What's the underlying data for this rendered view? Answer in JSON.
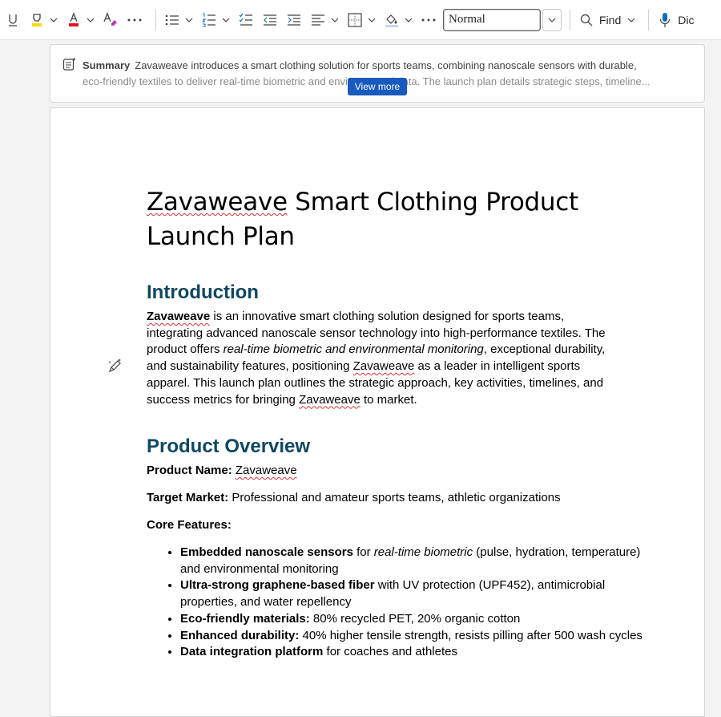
{
  "toolbar": {
    "style_value": "Normal",
    "find_label": "Find",
    "dictate_label": "Dic",
    "icons": [
      "underline-icon",
      "highlight-icon",
      "font-color-icon",
      "clear-formatting-icon",
      "more-icon",
      "bullets-icon",
      "numbering-icon",
      "checklist-icon",
      "decrease-indent-icon",
      "increase-indent-icon",
      "align-icon",
      "borders-icon",
      "shading-icon",
      "more-icon",
      "search-icon",
      "microphone-icon"
    ],
    "colors": {
      "font_color_bar": "#e81123",
      "highlight_bar": "#ffd800",
      "accent": "#185abd"
    }
  },
  "summary": {
    "title": "Summary",
    "line1": "Zavaweave introduces a smart clothing solution for sports teams, combining nanoscale sensors with durable,",
    "line2": "eco-friendly textiles to deliver real-time biometric and environmental data. The launch plan details strategic steps, timeline...",
    "view_more": "View more"
  },
  "document": {
    "title": "Zavaweave Smart Clothing Product Launch Plan",
    "intro": {
      "heading": "Introduction",
      "brand": "Zavaweave",
      "p1": " is an innovative smart clothing solution designed for sports teams, integrating advanced nanoscale sensor technology into high-performance textiles. The product offers ",
      "p2_italic": "real-time biometric and environmental monitoring",
      "p3": ", exceptional durability, and sustainability features, positioning ",
      "p4": " as a leader in intelligent sports apparel. This launch plan outlines the strategic approach, key activities, timelines, and success metrics for bringing ",
      "p5": " to market."
    },
    "overview": {
      "heading": "Product Overview",
      "product_name_label": "Product Name:",
      "product_name_value": "Zavaweave",
      "target_label": "Target Market:",
      "target_value": " Professional and amateur sports teams, athletic organizations",
      "core_label": "Core Features:",
      "features": [
        {
          "bold": "Embedded nanoscale sensors",
          "pre": " for ",
          "italic": "real-time biometric",
          "post": " (pulse, hydration, temperature) and environmental monitoring"
        },
        {
          "bold": "Ultra-strong graphene-based fiber",
          "pre": " with UV protection (UPF452), antimicrobial properties, and water repellency",
          "italic": "",
          "post": ""
        },
        {
          "bold": "Eco-friendly materials:",
          "pre": " 80% recycled PET, 20% organic cotton",
          "italic": "",
          "post": ""
        },
        {
          "bold": "Enhanced durability:",
          "pre": " 40% higher tensile strength, resists pilling after 500 wash cycles",
          "italic": "",
          "post": ""
        },
        {
          "bold": "Data integration platform",
          "pre": " for coaches and athletes",
          "italic": "",
          "post": ""
        }
      ]
    }
  }
}
